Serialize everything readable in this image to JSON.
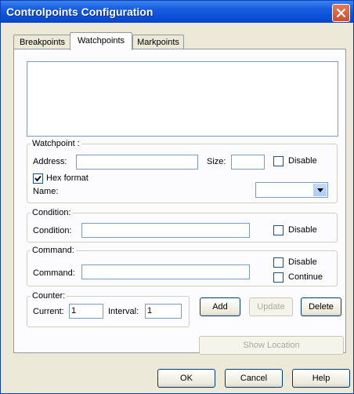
{
  "window": {
    "title": "Controlpoints Configuration",
    "tabs": [
      {
        "label": "Breakpoints",
        "active": false
      },
      {
        "label": "Watchpoints",
        "active": true
      },
      {
        "label": "Markpoints",
        "active": false
      }
    ]
  },
  "watchpoint": {
    "legend": "Watchpoint :",
    "address_label": "Address:",
    "address_value": "",
    "size_label": "Size:",
    "size_value": "",
    "disable_label": "Disable",
    "disable_checked": false,
    "hex_label": "Hex format",
    "hex_checked": true,
    "name_label": "Name:",
    "name_value": ""
  },
  "condition": {
    "legend": "Condition:",
    "label": "Condition:",
    "value": "",
    "disable_label": "Disable",
    "disable_checked": false
  },
  "command": {
    "legend": "Command:",
    "label": "Command:",
    "value": "",
    "disable_label": "Disable",
    "disable_checked": false,
    "continue_label": "Continue",
    "continue_checked": false
  },
  "counter": {
    "legend": "Counter:",
    "current_label": "Current:",
    "current_value": "1",
    "interval_label": "Interval:",
    "interval_value": "1"
  },
  "actions": {
    "add": "Add",
    "update": "Update",
    "delete": "Delete",
    "show_location": "Show Location"
  },
  "footer": {
    "ok": "OK",
    "cancel": "Cancel",
    "help": "Help"
  },
  "icons": {
    "close": "close-icon",
    "checkmark": "checkmark-icon",
    "dropdown": "chevron-down-icon"
  },
  "colors": {
    "titlebar": "#0b50d8",
    "close_button": "#d54a2b",
    "dialog_bg": "#ece9d8",
    "disabled_text": "#aca899"
  }
}
